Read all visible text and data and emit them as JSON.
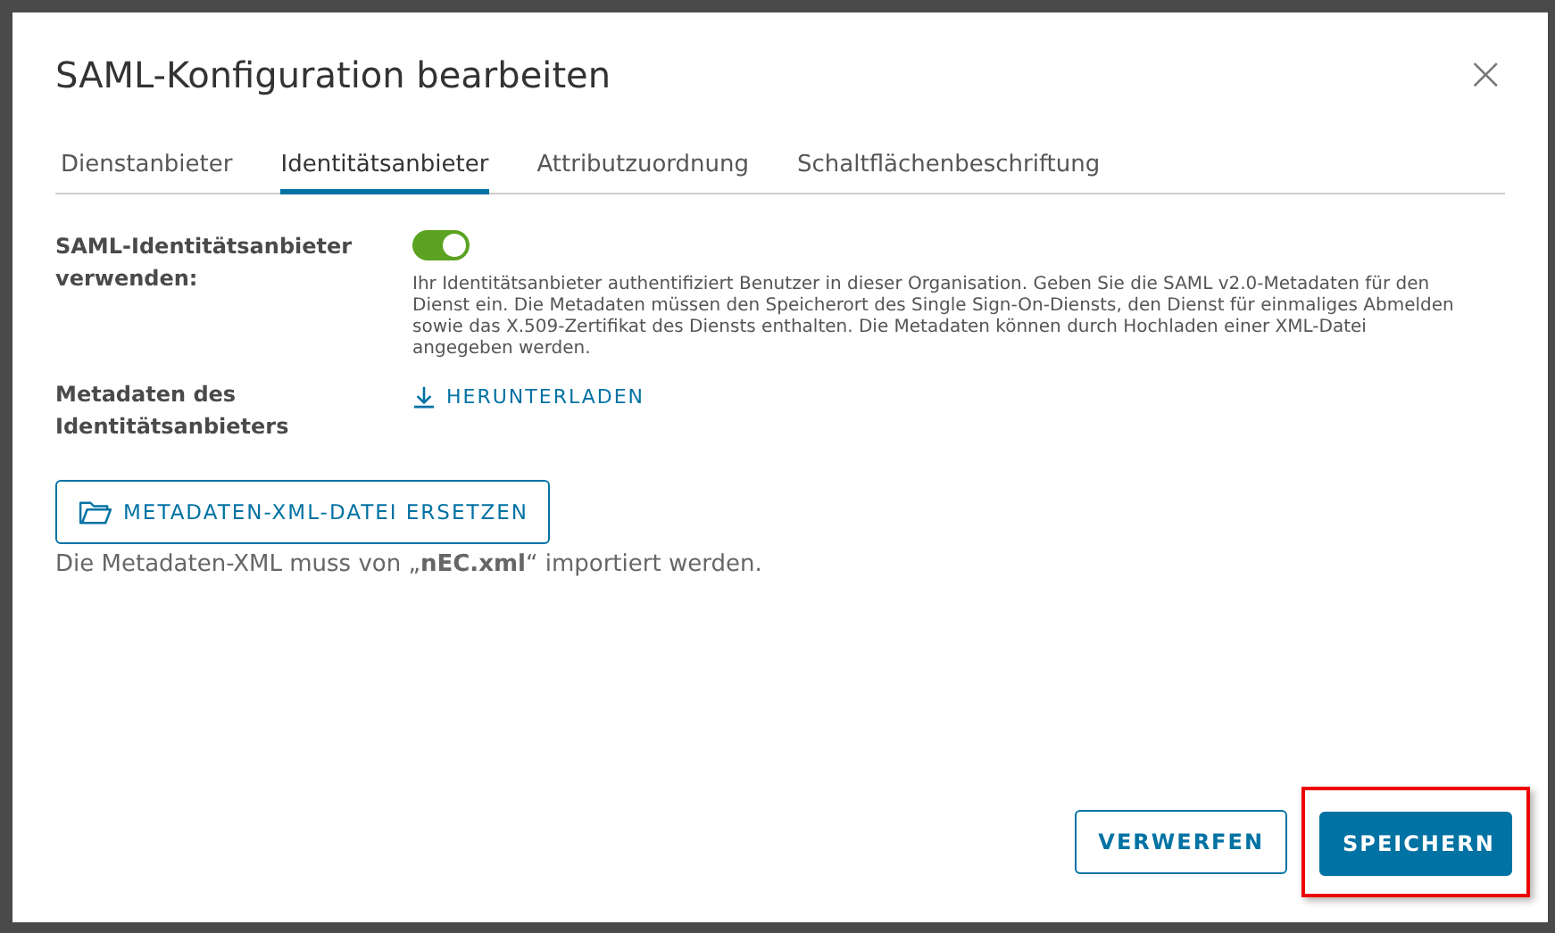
{
  "dialog": {
    "title": "SAML-Konfiguration bearbeiten",
    "close": "×"
  },
  "tabs": [
    {
      "label": "Dienstanbieter",
      "selected": false
    },
    {
      "label": "Identitätsanbieter",
      "selected": true
    },
    {
      "label": "Attributzuordnung",
      "selected": false
    },
    {
      "label": "Schaltflächenbeschriftung",
      "selected": false
    }
  ],
  "toggle_row": {
    "label": "SAML-Identitätsanbieter verwenden:",
    "on": true,
    "help": "Ihr Identitätsanbieter authentifiziert Benutzer in dieser Organisation. Geben Sie die SAML v2.0-Metadaten für den Dienst ein. Die Metadaten müssen den Speicherort des Single Sign-On-Diensts, den Dienst für einmaliges Abmelden sowie das X.509-Zertifikat des Diensts enthalten. Die Metadaten können durch Hochladen einer XML-Datei angegeben werden."
  },
  "metadata_row": {
    "label": "Metadaten des Identitätsanbieters",
    "link": "HERUNTERLADEN"
  },
  "replace_button": "METADATEN-XML-DATEI ERSETZEN",
  "note": "Die Metadaten-XML muss von „**nEC.xml**“ importiert werden.",
  "footer_buttons": [
    {
      "label": "VERWERFEN",
      "kind": "outline",
      "highlighted": false
    },
    {
      "label": "SPEICHERN",
      "kind": "primary",
      "highlighted": true
    }
  ]
}
